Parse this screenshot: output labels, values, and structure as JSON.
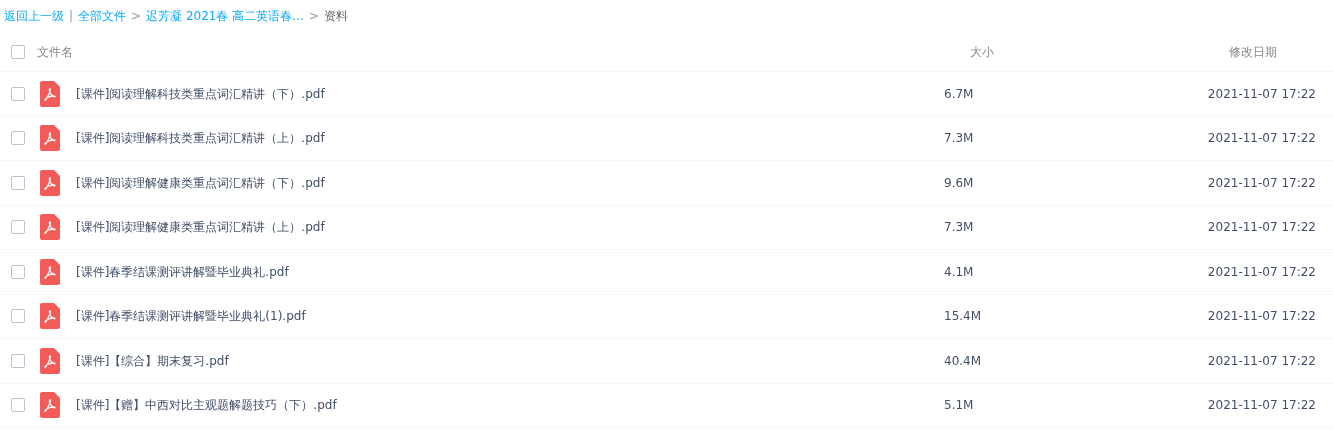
{
  "breadcrumb": [
    {
      "label": "返回上一级",
      "kind": "link"
    },
    {
      "label": "|",
      "kind": "separator"
    },
    {
      "label": "全部文件",
      "kind": "link"
    },
    {
      "label": ">",
      "kind": "separator"
    },
    {
      "label": "迟芳凝 2021春 高二英语春...",
      "kind": "link"
    },
    {
      "label": ">",
      "kind": "separator"
    },
    {
      "label": "资料",
      "kind": "current"
    }
  ],
  "table": {
    "select_all": {
      "checked": false
    },
    "columns": [
      "文件名",
      "大小",
      "修改日期"
    ],
    "rows": [
      {
        "checked": false,
        "name": "[课件]阅读理解科技类重点词汇精讲（下）.pdf",
        "size": "6.7M",
        "modified": "2021-11-07 17:22"
      },
      {
        "checked": false,
        "name": "[课件]阅读理解科技类重点词汇精讲（上）.pdf",
        "size": "7.3M",
        "modified": "2021-11-07 17:22"
      },
      {
        "checked": false,
        "name": "[课件]阅读理解健康类重点词汇精讲（下）.pdf",
        "size": "9.6M",
        "modified": "2021-11-07 17:22"
      },
      {
        "checked": false,
        "name": "[课件]阅读理解健康类重点词汇精讲（上）.pdf",
        "size": "7.3M",
        "modified": "2021-11-07 17:22"
      },
      {
        "checked": false,
        "name": "[课件]春季结课测评讲解暨毕业典礼.pdf",
        "size": "4.1M",
        "modified": "2021-11-07 17:22"
      },
      {
        "checked": false,
        "name": "[课件]春季结课测评讲解暨毕业典礼(1).pdf",
        "size": "15.4M",
        "modified": "2021-11-07 17:22"
      },
      {
        "checked": false,
        "name": "[课件]【综合】期末复习.pdf",
        "size": "40.4M",
        "modified": "2021-11-07 17:22"
      },
      {
        "checked": false,
        "name": "[课件]【赠】中西对比主观题解题技巧（下）.pdf",
        "size": "5.1M",
        "modified": "2021-11-07 17:22"
      }
    ]
  }
}
